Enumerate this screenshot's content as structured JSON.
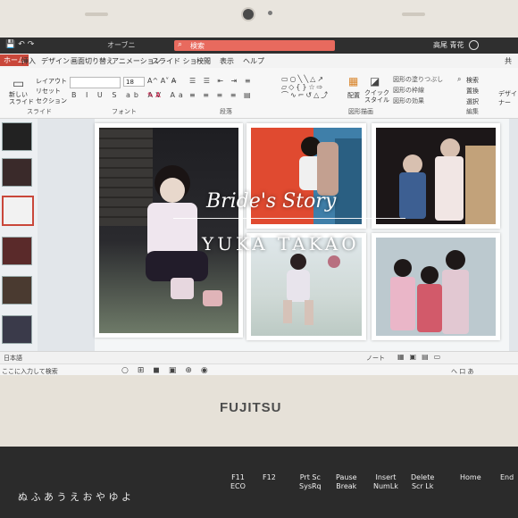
{
  "window": {
    "title": "オーブニ",
    "search_placeholder": "検索",
    "user_name": "高尾 青花"
  },
  "ribbon": {
    "tabs": [
      {
        "label": "ホーム",
        "active": true
      },
      {
        "label": "挿入"
      },
      {
        "label": "デザイン"
      },
      {
        "label": "画面切り替え"
      },
      {
        "label": "アニメーション"
      },
      {
        "label": "スライド ショー"
      },
      {
        "label": "校閲"
      },
      {
        "label": "表示"
      },
      {
        "label": "ヘルプ"
      }
    ],
    "share_label": "共",
    "slides_group": {
      "new_slide": "新しい\nスライド",
      "layout": "レイアウト",
      "reset": "リセット",
      "section": "セクション",
      "group_label": "スライド"
    },
    "font_group": {
      "font_size": "18",
      "group_label": "フォント"
    },
    "paragraph_group": {
      "group_label": "段落"
    },
    "drawing_group": {
      "arrange": "配置",
      "quick_styles": "クイック\nスタイル",
      "fill": "図形の塗りつぶし",
      "outline": "図形の枠線",
      "effects": "図形の効果",
      "group_label": "図形描画"
    },
    "editing_group": {
      "find": "検索",
      "replace": "置換",
      "select": "選択",
      "group_label": "編集"
    },
    "designer": "デザイナー"
  },
  "slide": {
    "title": "Bride's Story",
    "subtitle": "YUKA TAKAO"
  },
  "status": {
    "language": "日本語",
    "notes": "ノート"
  },
  "taskbar": {
    "search_text": "ここに入力して検索",
    "tray_text": "へ 口 あ"
  },
  "laptop": {
    "brand": "FUJITSU",
    "fkeys": [
      {
        "num": "F11",
        "label": "ECO"
      },
      {
        "num": "F12",
        "label": ""
      },
      {
        "num": "Prt Sc",
        "label": "SysRq"
      },
      {
        "num": "Pause",
        "label": "Break"
      },
      {
        "num": "Insert",
        "label": "NumLk"
      },
      {
        "num": "Delete",
        "label": "Scr Lk"
      },
      {
        "num": "Home",
        "label": ""
      },
      {
        "num": "End",
        "label": ""
      }
    ],
    "kana_row": "ぬ ふ あ う え お や ゆ よ"
  }
}
